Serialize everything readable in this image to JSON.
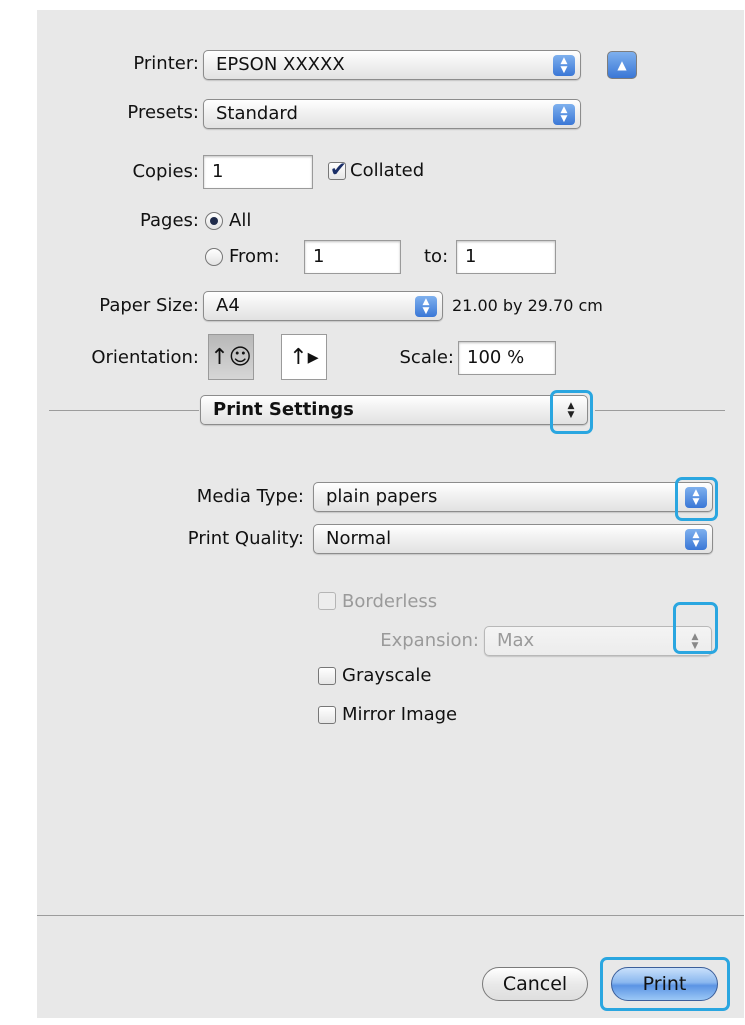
{
  "printer": {
    "label": "Printer:",
    "value": "EPSON XXXXX"
  },
  "presets": {
    "label": "Presets:",
    "value": "Standard"
  },
  "copies": {
    "label": "Copies:",
    "value": "1",
    "collated_label": "Collated",
    "collated_checked": true
  },
  "pages": {
    "label": "Pages:",
    "all_label": "All",
    "from_label": "From:",
    "from_value": "1",
    "to_label": "to:",
    "to_value": "1",
    "selected": "All"
  },
  "paper_size": {
    "label": "Paper Size:",
    "value": "A4",
    "dimensions": "21.00 by 29.70 cm"
  },
  "orientation": {
    "label": "Orientation:",
    "selected": "portrait",
    "portrait_glyph": "↑☺",
    "landscape_glyph": "↑▸"
  },
  "scale": {
    "label": "Scale:",
    "value": "100 %"
  },
  "section_menu": {
    "value": "Print Settings"
  },
  "media_type": {
    "label": "Media Type:",
    "value": "plain papers"
  },
  "print_quality": {
    "label": "Print Quality:",
    "value": "Normal"
  },
  "borderless": {
    "label": "Borderless",
    "checked": false,
    "enabled": false
  },
  "expansion": {
    "label": "Expansion:",
    "value": "Max",
    "enabled": false
  },
  "grayscale": {
    "label": "Grayscale",
    "checked": false
  },
  "mirror_image": {
    "label": "Mirror Image",
    "checked": false
  },
  "buttons": {
    "cancel": "Cancel",
    "print": "Print"
  },
  "glyphs": {
    "updown": "▲▼",
    "disclosure": "▲",
    "check": "✔"
  },
  "colors": {
    "accent": "#3a77d6",
    "highlight": "#2aa6e0",
    "dialog_bg": "#e8e8e8"
  }
}
